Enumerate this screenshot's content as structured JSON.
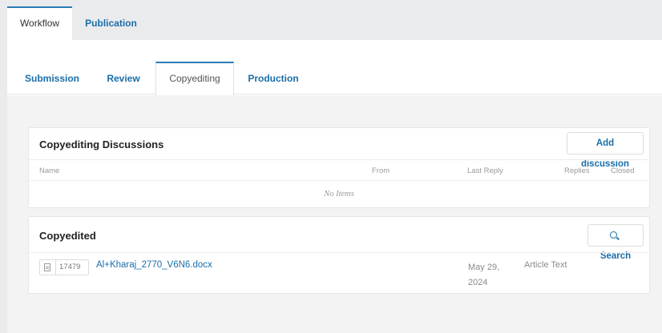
{
  "top_tabs": [
    {
      "label": "Workflow",
      "active": true
    },
    {
      "label": "Publication",
      "active": false
    }
  ],
  "stage_tabs": [
    {
      "label": "Submission",
      "active": false
    },
    {
      "label": "Review",
      "active": false
    },
    {
      "label": "Copyediting",
      "active": true
    },
    {
      "label": "Production",
      "active": false
    }
  ],
  "discussions": {
    "title": "Copyediting Discussions",
    "add_button": "Add discussion",
    "columns": {
      "name": "Name",
      "from": "From",
      "last_reply": "Last Reply",
      "replies": "Replies",
      "closed": "Closed"
    },
    "empty_text": "No Items"
  },
  "copyedited": {
    "title": "Copyedited",
    "search_button": "Search",
    "search_icon": "search-icon",
    "files": [
      {
        "id": "17479",
        "icon": "document-icon",
        "name": "Al+Kharaj_2770_V6N6.docx",
        "date": "May 29, 2024",
        "type": "Article Text"
      }
    ]
  },
  "colors": {
    "link": "#1a6ea8",
    "active_border": "#2b7bb4",
    "background": "#e9ebed"
  }
}
